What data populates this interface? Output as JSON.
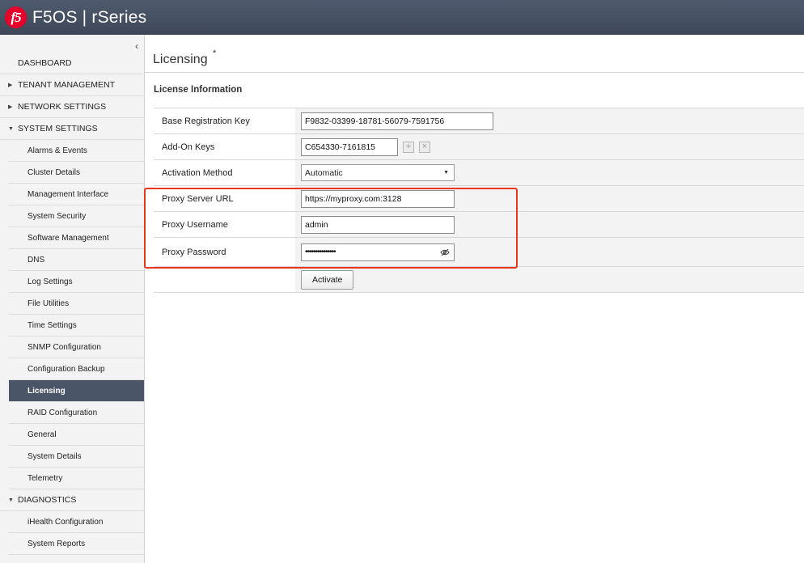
{
  "header": {
    "logo_text": "f5",
    "app_title": "F5OS | rSeries"
  },
  "sidebar": {
    "collapse_glyph": "‹",
    "dashboard": "DASHBOARD",
    "sections": [
      {
        "label": "TENANT MANAGEMENT",
        "expanded": false
      },
      {
        "label": "NETWORK SETTINGS",
        "expanded": false
      },
      {
        "label": "SYSTEM SETTINGS",
        "expanded": true
      }
    ],
    "system_settings_items": [
      "Alarms & Events",
      "Cluster Details",
      "Management Interface",
      "System Security",
      "Software Management",
      "DNS",
      "Log Settings",
      "File Utilities",
      "Time Settings",
      "SNMP Configuration",
      "Configuration Backup",
      "Licensing",
      "RAID Configuration",
      "General",
      "System Details",
      "Telemetry"
    ],
    "active_item": "Licensing",
    "diagnostics": {
      "label": "DIAGNOSTICS",
      "expanded": true
    },
    "diagnostics_items": [
      "iHealth Configuration",
      "System Reports"
    ]
  },
  "page": {
    "title": "Licensing",
    "title_marker": "*",
    "section_title": "License Information"
  },
  "form": {
    "base_key_label": "Base Registration Key",
    "base_key_value": "F9832-03399-18781-56079-7591756",
    "addon_label": "Add-On Keys",
    "addon_value": "C654330-7161815",
    "addon_add_glyph": "+",
    "addon_remove_glyph": "×",
    "activation_label": "Activation Method",
    "activation_value": "Automatic",
    "proxy_url_label": "Proxy Server URL",
    "proxy_url_value": "https://myproxy.com:3128",
    "proxy_user_label": "Proxy Username",
    "proxy_user_value": "admin",
    "proxy_pass_label": "Proxy Password",
    "proxy_pass_value": "•••••••••••••••",
    "activate_label": "Activate"
  },
  "colors": {
    "header": "#4a5568",
    "active_nav": "#4a5568",
    "highlight": "#e8361b",
    "logo": "#e4002b"
  },
  "icons": {
    "collapse": "chevron-left-icon",
    "expand": "caret-right-icon",
    "expanded": "caret-down-icon",
    "password_toggle": "eye-slash-icon"
  }
}
